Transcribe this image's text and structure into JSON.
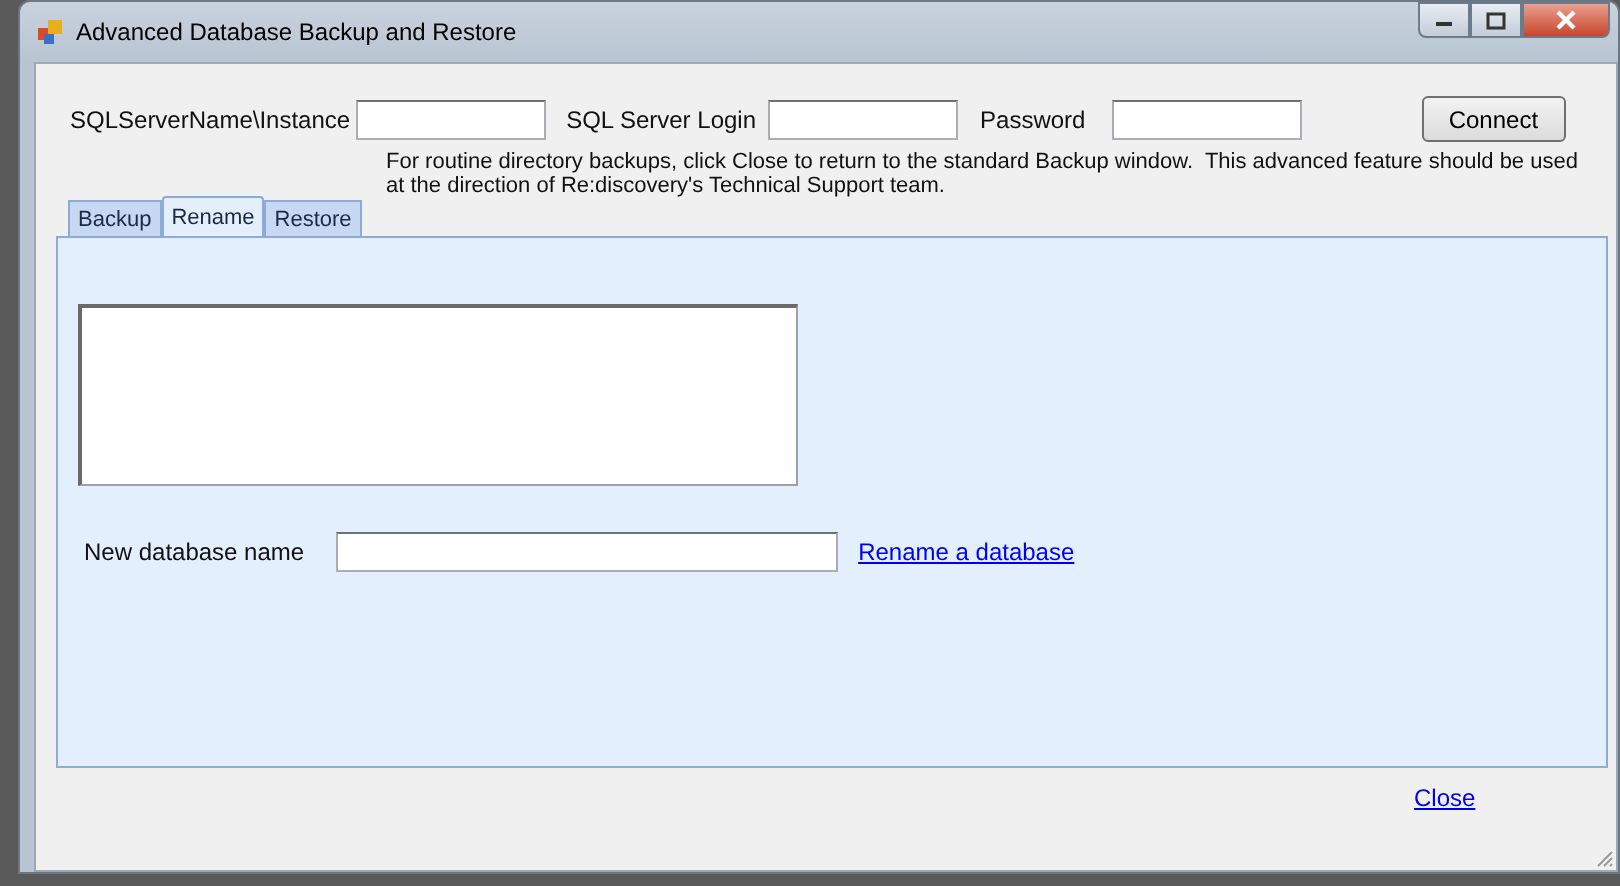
{
  "window": {
    "title": "Advanced Database Backup and Restore"
  },
  "connection": {
    "server_label": "SQLServerName\\Instance",
    "login_label": "SQL Server Login",
    "password_label": "Password",
    "connect_button": "Connect"
  },
  "notice": "For routine directory backups, click Close to return to the standard Backup window.  This advanced feature should be used at the direction of Re:discovery's Technical Support team.",
  "tabs": [
    {
      "label": "Backup",
      "selected": false
    },
    {
      "label": "Rename",
      "selected": true
    },
    {
      "label": "Restore",
      "selected": false
    }
  ],
  "rename": {
    "new_name_label": "New database name",
    "rename_link": "Rename a database"
  },
  "close_link": "Close"
}
